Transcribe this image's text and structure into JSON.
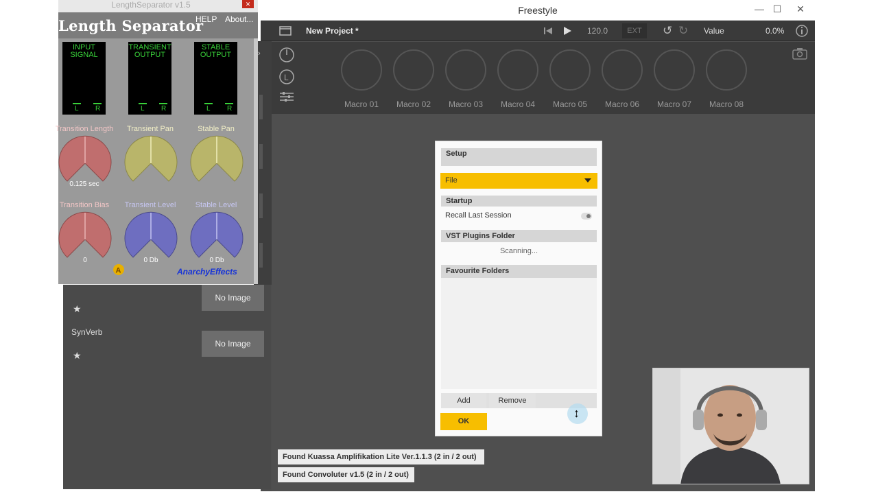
{
  "freestyle": {
    "window_title": "Freestyle",
    "project_name": "New Project *",
    "tempo": "120.0",
    "ext_label": "EXT",
    "value_label": "Value",
    "value_readout": "0.0%",
    "macros": [
      "Macro 01",
      "Macro 02",
      "Macro 03",
      "Macro 04",
      "Macro 05",
      "Macro 06",
      "Macro 07",
      "Macro 08"
    ]
  },
  "plugin": {
    "window_title": "LengthSeparator v1.5",
    "name": "Length Separator",
    "help_label": "HELP",
    "about_label": "About...",
    "meters": [
      {
        "line1": "INPUT",
        "line2": "SIGNAL"
      },
      {
        "line1": "TRANSIENT",
        "line2": "OUTPUT"
      },
      {
        "line1": "STABLE",
        "line2": "OUTPUT"
      }
    ],
    "lr": {
      "l": "L",
      "r": "R"
    },
    "knobs_row1": [
      {
        "label": "Transition Length",
        "value": "0.125 sec",
        "color": "#c06e6e"
      },
      {
        "label": "Transient Pan",
        "value": "",
        "color": "#b9b56a"
      },
      {
        "label": "Stable Pan",
        "value": "",
        "color": "#b9b56a"
      }
    ],
    "knobs_row2": [
      {
        "label": "Transition Bias",
        "value": "0",
        "color": "#c06e6e"
      },
      {
        "label": "Transient Level",
        "value": "0 Db",
        "color": "#6e6ec0"
      },
      {
        "label": "Stable Level",
        "value": "0 Db",
        "color": "#6e6ec0"
      }
    ],
    "brand": "AnarchyEffects"
  },
  "browser": {
    "items": [
      {
        "name": "",
        "image_label": "No Image"
      },
      {
        "name": "SynVerb",
        "image_label": "No Image"
      }
    ],
    "favorite_icon": "star-icon"
  },
  "setup_dialog": {
    "title": "Setup",
    "category_selected": "File",
    "startup_header": "Startup",
    "recall_label": "Recall Last Session",
    "vst_header": "VST Plugins Folder",
    "scanning_text": "Scanning...",
    "favourites_header": "Favourite Folders",
    "add_label": "Add",
    "remove_label": "Remove",
    "ok_label": "OK",
    "accent_color": "#f7be00"
  },
  "notifications": [
    "Found Kuassa Amplifikation Lite Ver.1.1.3 (2 in / 2 out)",
    "Found Convoluter v1.5 (2 in / 2 out)"
  ]
}
